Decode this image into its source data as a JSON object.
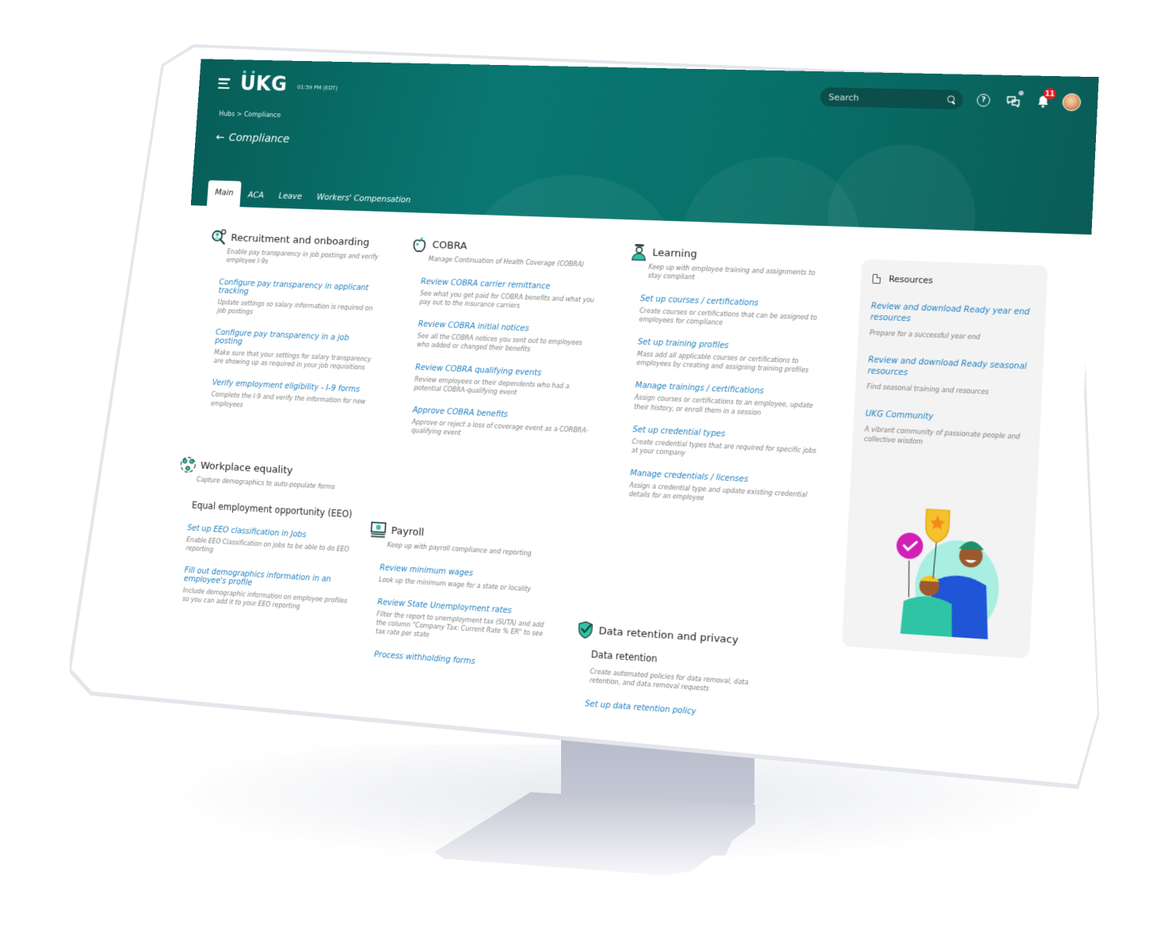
{
  "header": {
    "logo": "UKG",
    "clock": "01:59 PM (EDT)",
    "search_placeholder": "Search",
    "notification_count": "11",
    "breadcrumb": "Hubs > Compliance",
    "page_title": "Compliance",
    "tabs": [
      {
        "label": "Main",
        "active": true
      },
      {
        "label": "ACA",
        "active": false
      },
      {
        "label": "Leave",
        "active": false
      },
      {
        "label": "Workers' Compensation",
        "active": false
      }
    ]
  },
  "colors": {
    "header_teal": "#0a7772",
    "link_blue": "#1f7fc0",
    "accent_mint": "#2ec4a5",
    "badge_red": "#e11b22"
  },
  "sections": {
    "recruitment": {
      "icon": "magnifier-people-icon",
      "title": "Recruitment and onboarding",
      "desc": "Enable pay transparency in job postings and verify employee I-9s",
      "items": [
        {
          "link": "Configure pay transparency in applicant tracking",
          "desc": "Update settings so salary information is required on job postings"
        },
        {
          "link": "Configure pay transparency in a job posting",
          "desc": "Make sure that your settings for salary transparency are showing up as required in your job requisitions"
        },
        {
          "link": "Verify employment eligibility - I-9 forms",
          "desc": "Complete the I-9 and verify the information for new employees"
        }
      ]
    },
    "cobra": {
      "icon": "apple-icon",
      "title": "COBRA",
      "desc": "Manage Continuation of Health Coverage (COBRA)",
      "items": [
        {
          "link": "Review COBRA carrier remittance",
          "desc": "See what you get paid for COBRA benefits and what you pay out to the insurance carriers"
        },
        {
          "link": "Review COBRA initial notices",
          "desc": "See all the COBRA notices you sent out to employees who added or changed their benefits"
        },
        {
          "link": "Review COBRA qualifying events",
          "desc": "Review employees or their dependents who had a potential COBRA-qualifying event"
        },
        {
          "link": "Approve COBRA benefits",
          "desc": "Approve or reject a loss of coverage event as a CORBRA-qualifying event"
        }
      ]
    },
    "learning": {
      "icon": "graduate-icon",
      "title": "Learning",
      "desc": "Keep up with employee training and assignments to stay compliant",
      "items": [
        {
          "link": "Set up courses / certifications",
          "desc": "Create courses or certifications that can be assigned to employees for compliance"
        },
        {
          "link": "Set up training profiles",
          "desc": "Mass add all applicable courses or certifications to employees by creating and assigning training profiles"
        },
        {
          "link": "Manage trainings / certifications",
          "desc": "Assign courses or certifications to an employee, update their history, or enroll them in a session"
        },
        {
          "link": "Set up credential types",
          "desc": "Create credential types that are required for specific jobs at your company"
        },
        {
          "link": "Manage credentials / licenses",
          "desc": "Assign a credential type and update existing credential details for an employee"
        }
      ]
    },
    "workplace": {
      "icon": "people-circle-icon",
      "title": "Workplace equality",
      "desc": "Capture demographics to auto-populate forms",
      "subhead": "Equal employment opportunity (EEO)",
      "items": [
        {
          "link": "Set up EEO classification in Jobs",
          "desc": "Enable EEO Classification on jobs to be able to do EEO reporting"
        },
        {
          "link": "Fill out demographics information in an employee's profile",
          "desc": "Include demographic information on employee profiles so you can add it to your EEO reporting"
        }
      ]
    },
    "payroll": {
      "icon": "paycheck-icon",
      "title": "Payroll",
      "desc": "Keep up with payroll compliance and reporting",
      "items": [
        {
          "link": "Review minimum wages",
          "desc": "Look up the minimum wage for a state or locality"
        },
        {
          "link": "Review State Unemployment rates",
          "desc": "Filter the report to unemployment tax (SUTA) and add the column \"Company Tax: Current Rate % ER\" to see tax rate per state"
        },
        {
          "link": "Process withholding forms",
          "desc": ""
        }
      ]
    },
    "data_retention": {
      "icon": "shield-check-icon",
      "title": "Data retention and privacy",
      "subhead": "Data retention",
      "desc": "Create automated policies for data removal, data retention, and data removal requests",
      "items": [
        {
          "link": "Set up data retention policy",
          "desc": ""
        }
      ]
    }
  },
  "resources": {
    "title": "Resources",
    "items": [
      {
        "link": "Review and download Ready year end resources",
        "desc": "Prepare for a successful year end"
      },
      {
        "link": "Review and download Ready seasonal resources",
        "desc": "Find seasonal training and resources"
      },
      {
        "link": "UKG Community",
        "desc": "A vibrant community of passionate people and collective wisdom"
      }
    ]
  }
}
